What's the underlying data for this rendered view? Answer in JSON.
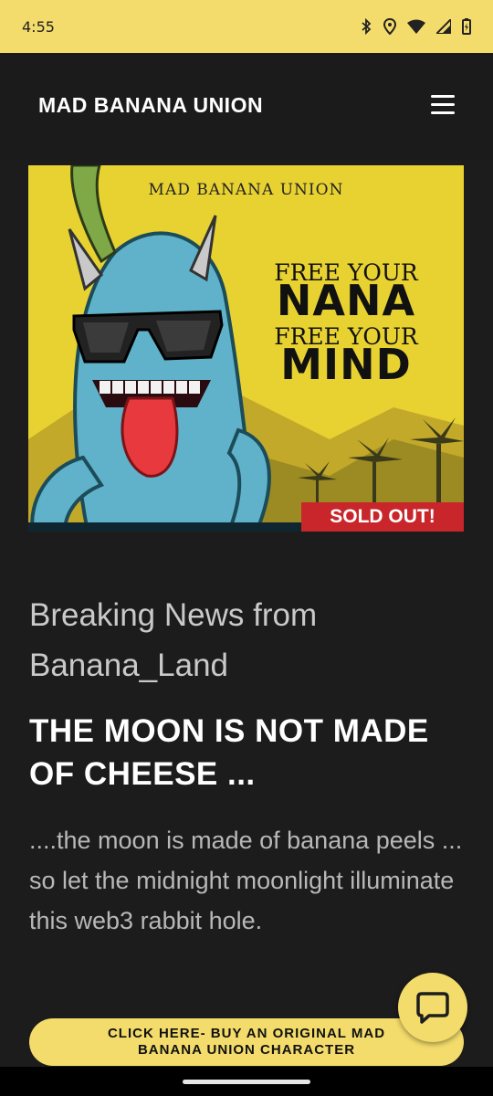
{
  "status_bar": {
    "time": "4:55",
    "icons": [
      "bluetooth-icon",
      "location-icon",
      "wifi-icon",
      "signal-icon",
      "battery-icon"
    ]
  },
  "header": {
    "brand": "MAD BANANA UNION",
    "menu_icon": "hamburger-menu-icon"
  },
  "hero": {
    "brand_text": "MAD BANANA UNION",
    "line1": "FREE YOUR",
    "line2": "NANA",
    "line3": "FREE YOUR",
    "line4": "MIND",
    "badge": "SOLD OUT!"
  },
  "article": {
    "title": "Breaking News from Banana_Land",
    "headline": "THE MOON IS NOT MADE OF CHEESE ...",
    "body": "....the moon is  made of banana peels ... so let the midnight moonlight illuminate this web3 rabbit hole."
  },
  "cta": {
    "label": "CLICK HERE- BUY AN ORIGINAL MAD BANANA UNION CHARACTER"
  },
  "chat": {
    "icon": "chat-bubble-icon"
  },
  "colors": {
    "accent": "#f3dc6b",
    "background": "#1c1c1c",
    "badge": "#c8262b"
  }
}
